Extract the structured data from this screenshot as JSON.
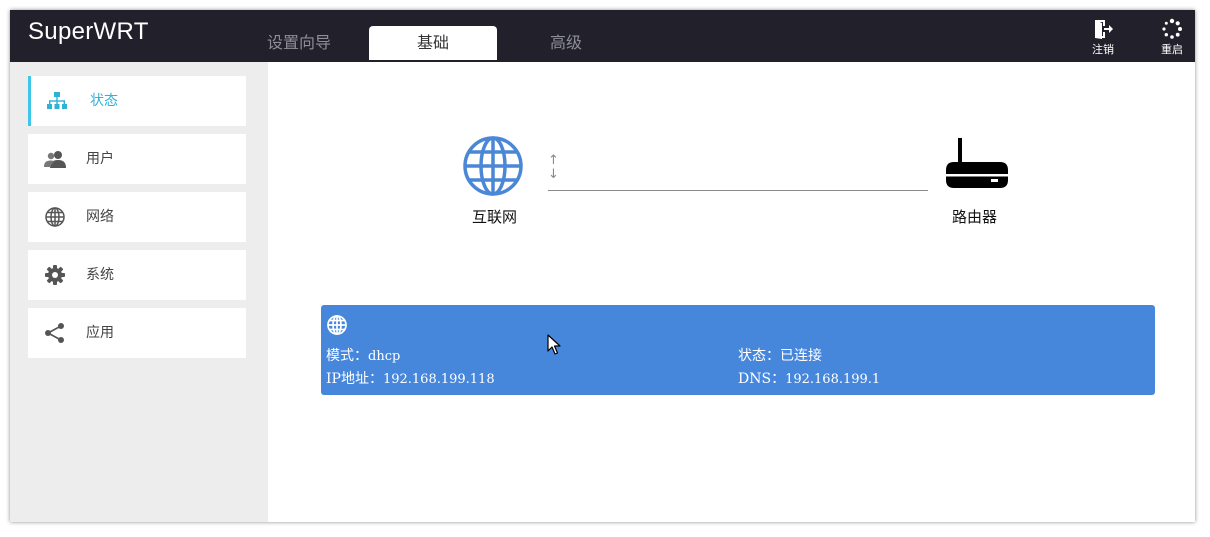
{
  "app": {
    "title": "SuperWRT"
  },
  "tabs": [
    {
      "label": "设置向导",
      "active": false
    },
    {
      "label": "基础",
      "active": true
    },
    {
      "label": "高级",
      "active": false
    }
  ],
  "top_actions": {
    "logout": {
      "label": "注销",
      "icon": "logout-icon"
    },
    "reboot": {
      "label": "重启",
      "icon": "spinner-icon"
    }
  },
  "sidebar": {
    "items": [
      {
        "label": "状态",
        "icon": "sitemap-icon",
        "active": true
      },
      {
        "label": "用户",
        "icon": "users-icon",
        "active": false
      },
      {
        "label": "网络",
        "icon": "globe-icon",
        "active": false
      },
      {
        "label": "系统",
        "icon": "gear-icon",
        "active": false
      },
      {
        "label": "应用",
        "icon": "share-icon",
        "active": false
      }
    ]
  },
  "topology": {
    "internet_label": "互联网",
    "router_label": "路由器",
    "arrow_up": "↑",
    "arrow_down": "↓"
  },
  "wan_info": {
    "mode_label": "模式：",
    "mode_value": "dhcp",
    "status_label": "状态：",
    "status_value": "已连接",
    "ip_label": "IP地址：",
    "ip_value": "192.168.199.118",
    "dns_label": "DNS：",
    "dns_value": "192.168.199.1"
  },
  "colors": {
    "topbar": "#22212b",
    "accent": "#3ec7e8",
    "info_panel": "#4687dc",
    "globe": "#4a87d6",
    "sidebar_bg": "#ededed"
  }
}
